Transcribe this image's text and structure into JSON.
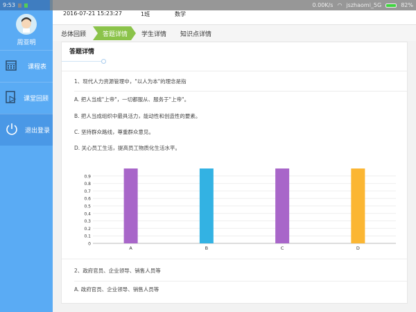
{
  "status": {
    "time": "9:53",
    "speed": "0.00K/s",
    "wifi": "jszhaomi_5G",
    "battery": "82%"
  },
  "sidebar": {
    "user": "周亚明",
    "items": [
      {
        "label": "课程表",
        "icon": "calendar-icon"
      },
      {
        "label": "课堂回顾",
        "icon": "video-icon"
      },
      {
        "label": "退出登录",
        "icon": "power-icon"
      }
    ]
  },
  "header": {
    "datetime": "2016-07-21 15:23:27",
    "class": "1班",
    "subject": "数学"
  },
  "tabs": [
    "总体回顾",
    "答题详情",
    "学生详情",
    "知识点详情"
  ],
  "card": {
    "title": "答题详情",
    "q1": {
      "text": "1、现代人力资源管理中，\"以人为本\"的理念是指",
      "options": [
        "A. 把人当成\"上帝\"，一切都服从、服务于\"上帝\"。",
        "B. 把人当成组织中最具活力，能动性和创造性的要素。",
        "C. 坚持群众路线，尊重群众意见。",
        "D. 关心员工生活，提高员工物质化生活水平。"
      ]
    },
    "q2": {
      "text": "2、政府官员、企业领导、销售人员等",
      "options": [
        "A. 政府官员、企业领导、销售人员等"
      ]
    }
  },
  "chart_data": {
    "type": "bar",
    "categories": [
      "A",
      "B",
      "C",
      "D"
    ],
    "values": [
      1,
      1,
      1,
      1
    ],
    "colors": [
      "#a866c9",
      "#33b2e3",
      "#a866c9",
      "#fbb633"
    ],
    "yticks": [
      "0",
      "0.1",
      "0.2",
      "0.3",
      "0.4",
      "0.5",
      "0.6",
      "0.7",
      "0.8",
      "0.9"
    ],
    "ylim": [
      0,
      1
    ],
    "grid": true
  }
}
